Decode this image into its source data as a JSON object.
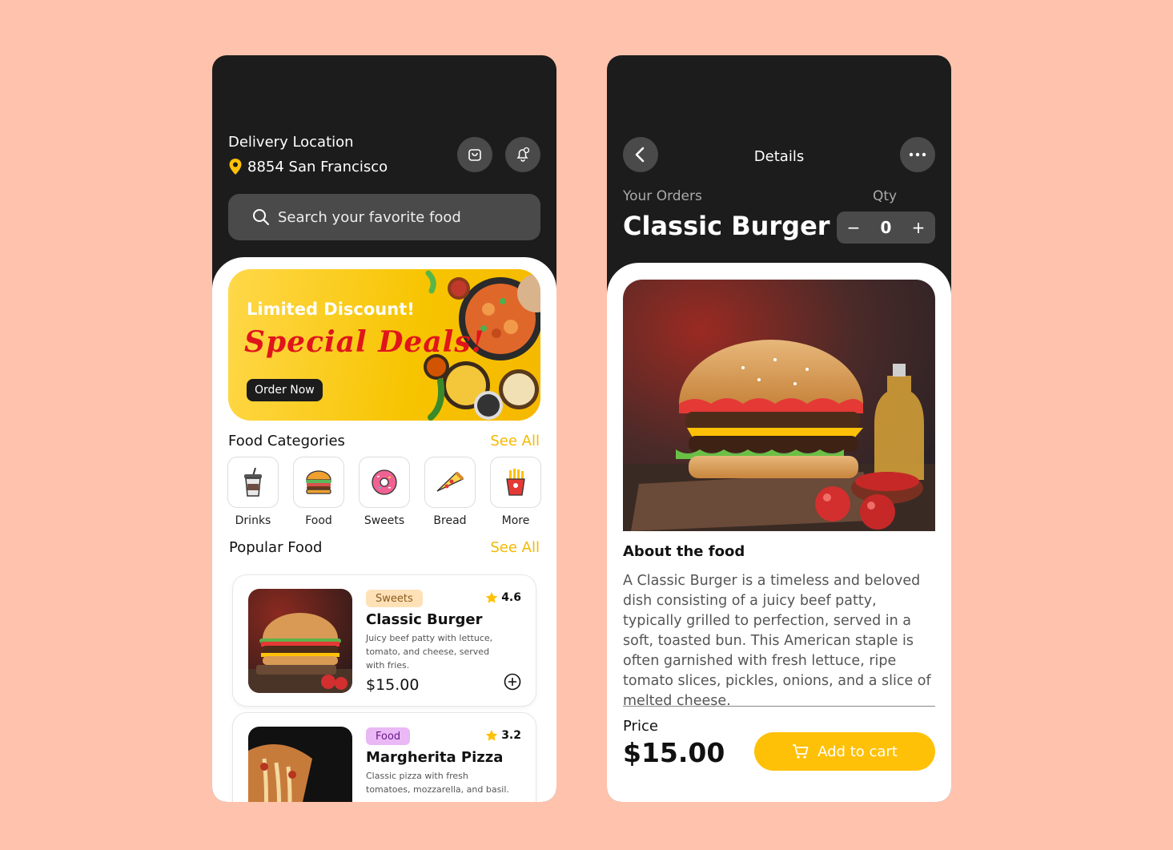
{
  "home": {
    "location_label": "Delivery Location",
    "location_value": "8854 San Francisco",
    "search_placeholder": "Search your favorite food",
    "banner": {
      "line1": "Limited Discount!",
      "line2": "Special Deals!",
      "cta": "Order Now"
    },
    "categories_title": "Food Categories",
    "see_all": "See All",
    "categories": [
      {
        "label": "Drinks",
        "icon": "drink-cup-icon"
      },
      {
        "label": "Food",
        "icon": "burger-icon"
      },
      {
        "label": "Sweets",
        "icon": "donut-icon"
      },
      {
        "label": "Bread",
        "icon": "pizza-slice-icon"
      },
      {
        "label": "More",
        "icon": "fries-icon"
      }
    ],
    "popular_title": "Popular Food",
    "popular": [
      {
        "tag": "Sweets",
        "rating": "4.6",
        "name": "Classic Burger",
        "desc": "Juicy beef patty with lettuce, tomato, and cheese, served with fries.",
        "price": "$15.00"
      },
      {
        "tag": "Food",
        "rating": "3.2",
        "name": "Margherita Pizza",
        "desc": "Classic pizza with fresh tomatoes, mozzarella, and basil.",
        "price": ""
      }
    ]
  },
  "details": {
    "header_title": "Details",
    "your_orders": "Your Orders",
    "qty_label": "Qty",
    "item_name": "Classic Burger",
    "qty_minus": "−",
    "qty_value": "0",
    "qty_plus": "+",
    "about_title": "About the food",
    "about_text": "A Classic Burger is a timeless and beloved dish consisting of a juicy beef patty, typically grilled to perfection, served in a soft, toasted bun. This American staple is often garnished with fresh lettuce, ripe tomato slices, pickles, onions, and a slice of melted cheese.",
    "price_label": "Price",
    "price_value": "$15.00",
    "add_to_cart": "Add to cart"
  },
  "colors": {
    "accent": "#FFC107",
    "dark": "#1C1C1C",
    "background": "#FFC2AD",
    "tag_sweets": "#FFE1B8",
    "tag_food": "#E9B8F5"
  }
}
